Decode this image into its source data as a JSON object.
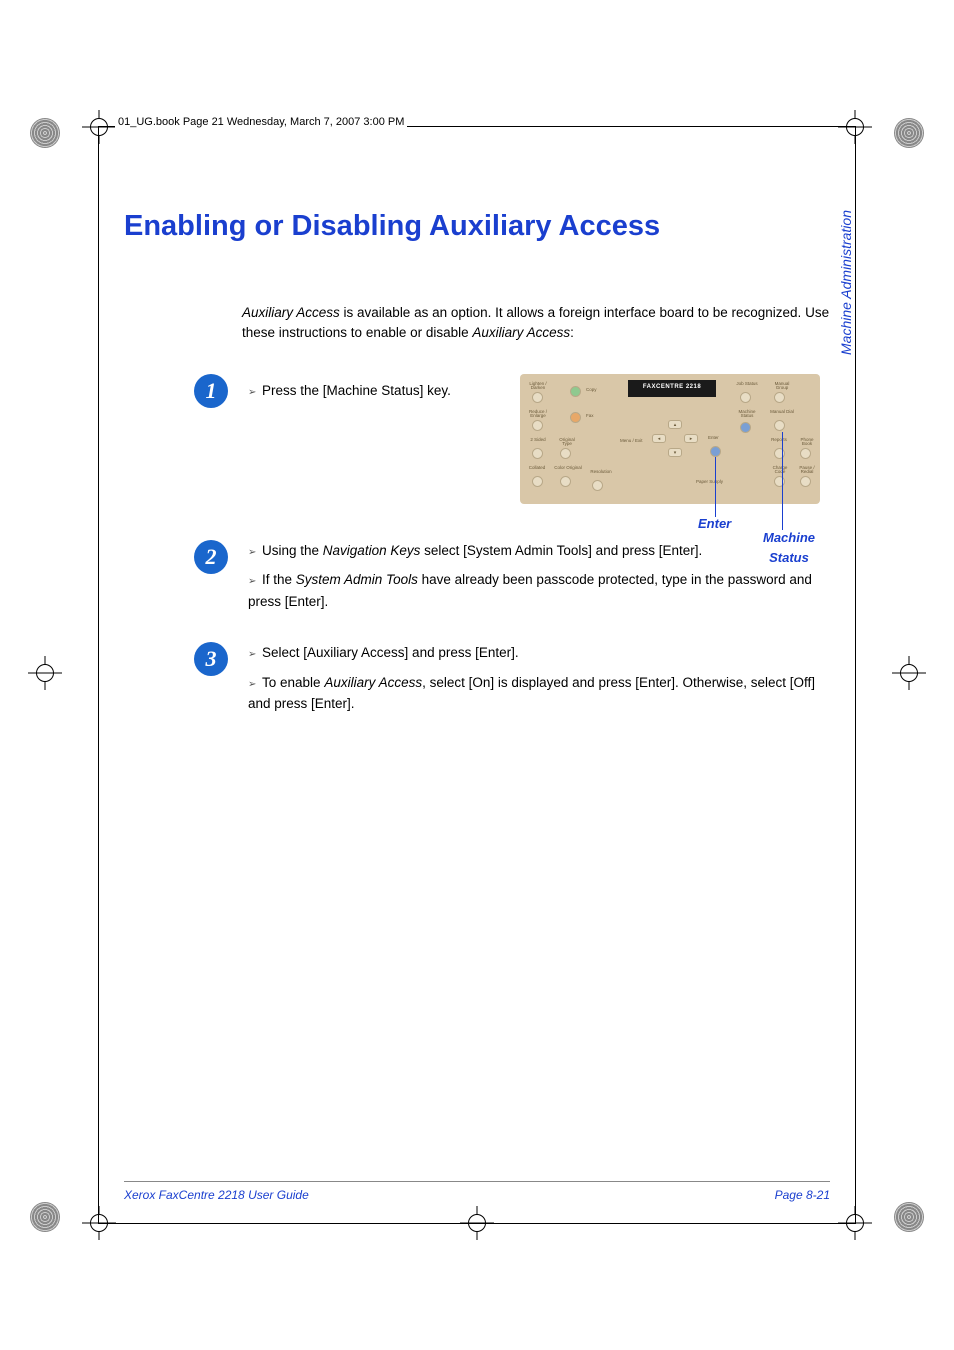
{
  "header_running": "01_UG.book  Page 21  Wednesday, March 7, 2007  3:00 PM",
  "side_tab": "Machine Administration",
  "title": "Enabling or Disabling Auxiliary Access",
  "intro": {
    "em1": "Auxiliary Access",
    "text1": " is available as an option. It allows a foreign interface board to be recognized. Use these instructions to enable or disable ",
    "em2": "Auxiliary Access",
    "text2": ":"
  },
  "steps": {
    "s1": {
      "num": "1",
      "b1": "Press the [Machine Status] key."
    },
    "s2": {
      "num": "2",
      "b1_pre": "Using the ",
      "b1_em": "Navigation Keys",
      "b1_post": " select [System Admin Tools] and press [Enter].",
      "b2_pre": "If the ",
      "b2_em": "System Admin Tools",
      "b2_post": " have already been passcode protected, type in the password and press [Enter]."
    },
    "s3": {
      "num": "3",
      "b1": "Select [Auxiliary Access] and press [Enter].",
      "b2_pre": "To enable ",
      "b2_em": "Auxiliary Access",
      "b2_post": ", select [On] is displayed and press [Enter]. Otherwise, select [Off] and press [Enter]."
    }
  },
  "panel": {
    "screen": "FAXCENTRE 2218",
    "callout_enter": "Enter",
    "callout_machine": "Machine Status",
    "labels": {
      "lighten": "Lighten / Darken",
      "copy": "Copy",
      "reduce": "Reduce / Enlarge",
      "fax": "Fax",
      "twosided": "2 Sided",
      "original_type": "Original Type",
      "collated": "Collated",
      "color_original": "Color Original",
      "resolution": "Resolution",
      "menu": "Menu / Exit",
      "enter": "Enter",
      "paper_supply": "Paper Supply",
      "job_status": "Job Status",
      "machine_status": "Machine Status",
      "manual_group": "Manual Group",
      "manual_dial": "Manual Dial",
      "reports": "Reports",
      "phone_book": "Phone Book",
      "charge_code": "Charge Code",
      "pause": "Pause / Redial"
    }
  },
  "footer": {
    "left": "Xerox FaxCentre 2218 User Guide",
    "right": "Page 8-21"
  }
}
